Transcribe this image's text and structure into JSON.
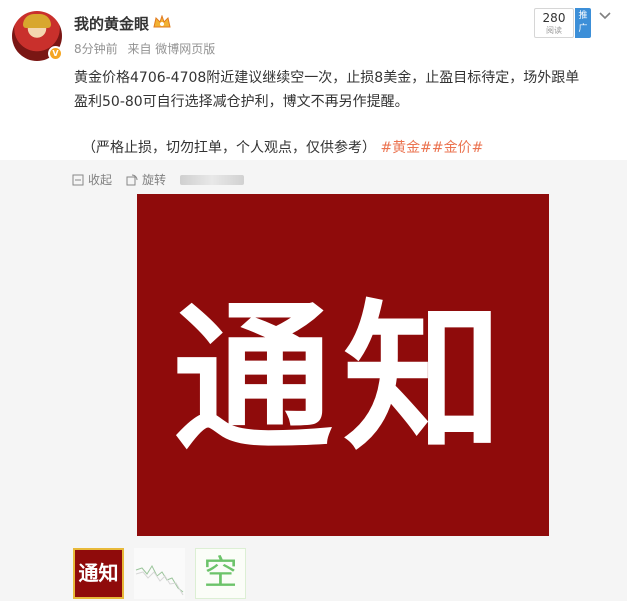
{
  "post": {
    "username": "我的黄金眼",
    "time": "8分钟前",
    "source": "来自 微博网页版",
    "read_count": "280",
    "read_label": "阅读",
    "promo_label": "推广",
    "line1": "黄金价格4706-4708附近建议继续空一次，止损8美金，止盈目标待定，场外跟单",
    "line2": "盈利50-80可自行选择减仓护利，博文不再另作提醒。",
    "disclaimer": "（严格止损，切勿扛单，个人观点，仅供参考）",
    "topics": "#黄金##金价#"
  },
  "actions": {
    "collect": "收起",
    "rotate": "旋转"
  },
  "image": {
    "text": "通知"
  },
  "thumbnails": {
    "t1": "通知",
    "t3": "空"
  },
  "colors": {
    "notice_red": "#8f0b0b",
    "topic_orange": "#eb7350",
    "promo_blue": "#3c8fd8"
  }
}
